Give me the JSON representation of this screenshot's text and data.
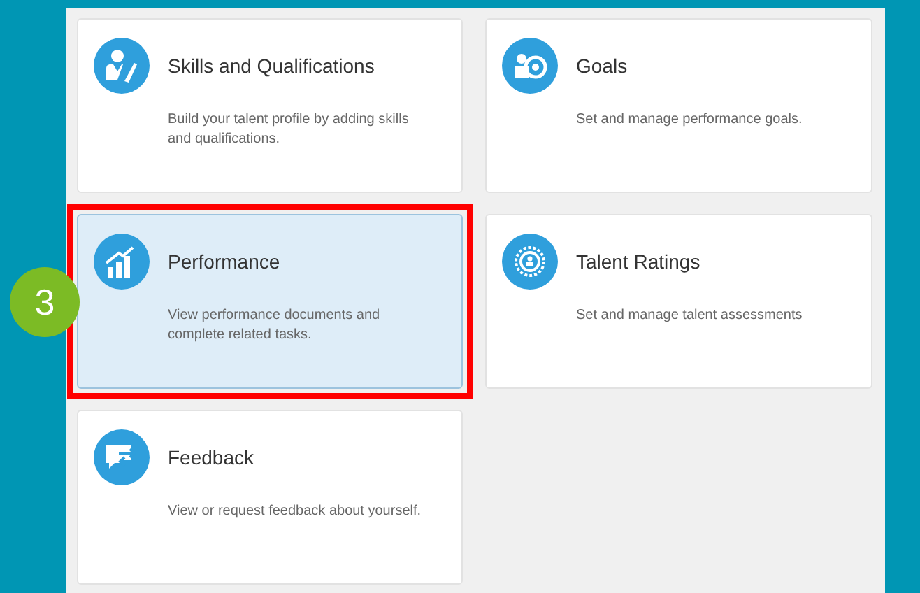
{
  "cards": [
    {
      "title": "Skills and Qualifications",
      "description": "Build your talent profile by adding skills and qualifications.",
      "selected": false
    },
    {
      "title": "Goals",
      "description": "Set and manage performance goals.",
      "selected": false
    },
    {
      "title": "Performance",
      "description": "View performance documents and complete related tasks.",
      "selected": true
    },
    {
      "title": "Talent Ratings",
      "description": "Set and manage talent assessments",
      "selected": false
    },
    {
      "title": "Feedback",
      "description": "View or request feedback about yourself.",
      "selected": false
    }
  ],
  "step_badge": {
    "label": "3"
  }
}
